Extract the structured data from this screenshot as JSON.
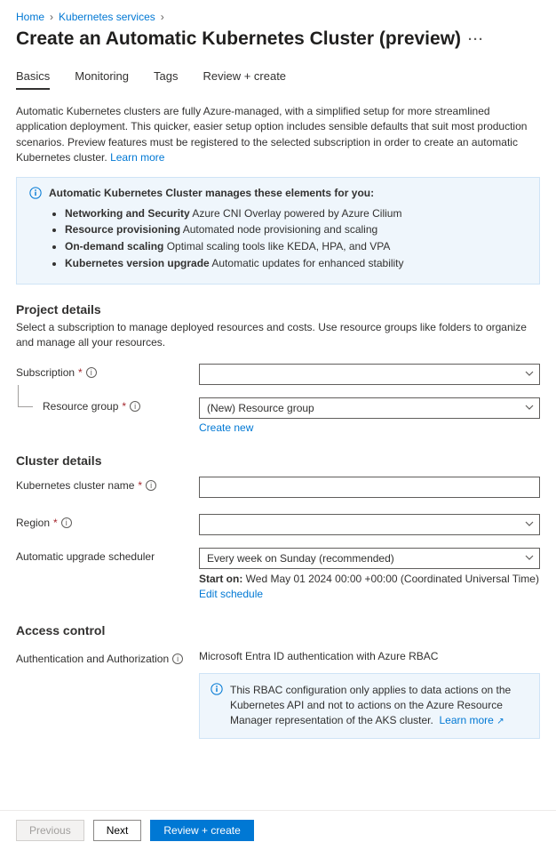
{
  "breadcrumb": {
    "home": "Home",
    "parent": "Kubernetes services"
  },
  "page_title": "Create an Automatic Kubernetes Cluster (preview)",
  "tabs": {
    "basics": "Basics",
    "monitoring": "Monitoring",
    "tags": "Tags",
    "review": "Review + create"
  },
  "intro_text": "Automatic Kubernetes clusters are fully Azure-managed, with a simplified setup for more streamlined application deployment. This quicker, easier setup option includes sensible defaults that suit most production scenarios. Preview features must be registered to the selected subscription in order to create an automatic Kubernetes cluster.",
  "intro_link": "Learn more",
  "info_box": {
    "header": "Automatic Kubernetes Cluster manages these elements for you:",
    "items": [
      {
        "bold": "Networking and Security",
        "rest": " Azure CNI Overlay powered by Azure Cilium"
      },
      {
        "bold": "Resource provisioning",
        "rest": " Automated node provisioning and scaling"
      },
      {
        "bold": "On-demand scaling",
        "rest": " Optimal scaling tools like KEDA, HPA, and VPA"
      },
      {
        "bold": "Kubernetes version upgrade",
        "rest": " Automatic updates for enhanced stability"
      }
    ]
  },
  "project": {
    "heading": "Project details",
    "sub": "Select a subscription to manage deployed resources and costs. Use resource groups like folders to organize and manage all your resources.",
    "subscription_label": "Subscription",
    "subscription_value": "",
    "resource_group_label": "Resource group",
    "resource_group_value": "(New) Resource group",
    "create_new": "Create new"
  },
  "cluster": {
    "heading": "Cluster details",
    "name_label": "Kubernetes cluster name",
    "name_value": "",
    "region_label": "Region",
    "region_value": "",
    "scheduler_label": "Automatic upgrade scheduler",
    "scheduler_value": "Every week on Sunday (recommended)",
    "start_on_label": "Start on:",
    "start_on_value": " Wed May 01 2024 00:00 +00:00 (Coordinated Universal Time)",
    "edit_schedule": "Edit schedule"
  },
  "access": {
    "heading": "Access control",
    "auth_label": "Authentication and Authorization",
    "auth_value": "Microsoft Entra ID authentication with Azure RBAC",
    "rbac_text": "This RBAC configuration only applies to data actions on the Kubernetes API and not to actions on the Azure Resource Manager representation of the AKS cluster.",
    "rbac_link": "Learn more"
  },
  "footer": {
    "previous": "Previous",
    "next": "Next",
    "review": "Review + create"
  }
}
